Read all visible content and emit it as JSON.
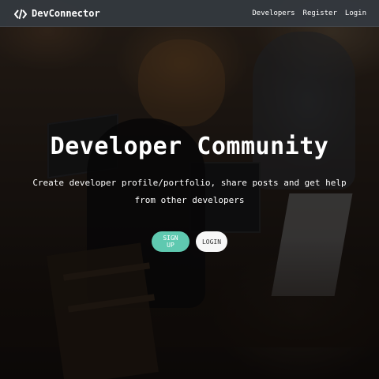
{
  "navbar": {
    "brand": "DevConnector",
    "links": [
      {
        "label": "Developers"
      },
      {
        "label": "Register"
      },
      {
        "label": "Login"
      }
    ]
  },
  "landing": {
    "title": "Developer Community",
    "lead": "Create developer profile/portfolio, share posts and get help from other developers",
    "buttons": {
      "signup": "SIGN UP",
      "login": "LOGIN"
    }
  },
  "icons": {
    "brand": "code-icon"
  },
  "colors": {
    "navbar": "#343a40",
    "primary": "#5fc9b0",
    "light": "#f7f7f7"
  }
}
